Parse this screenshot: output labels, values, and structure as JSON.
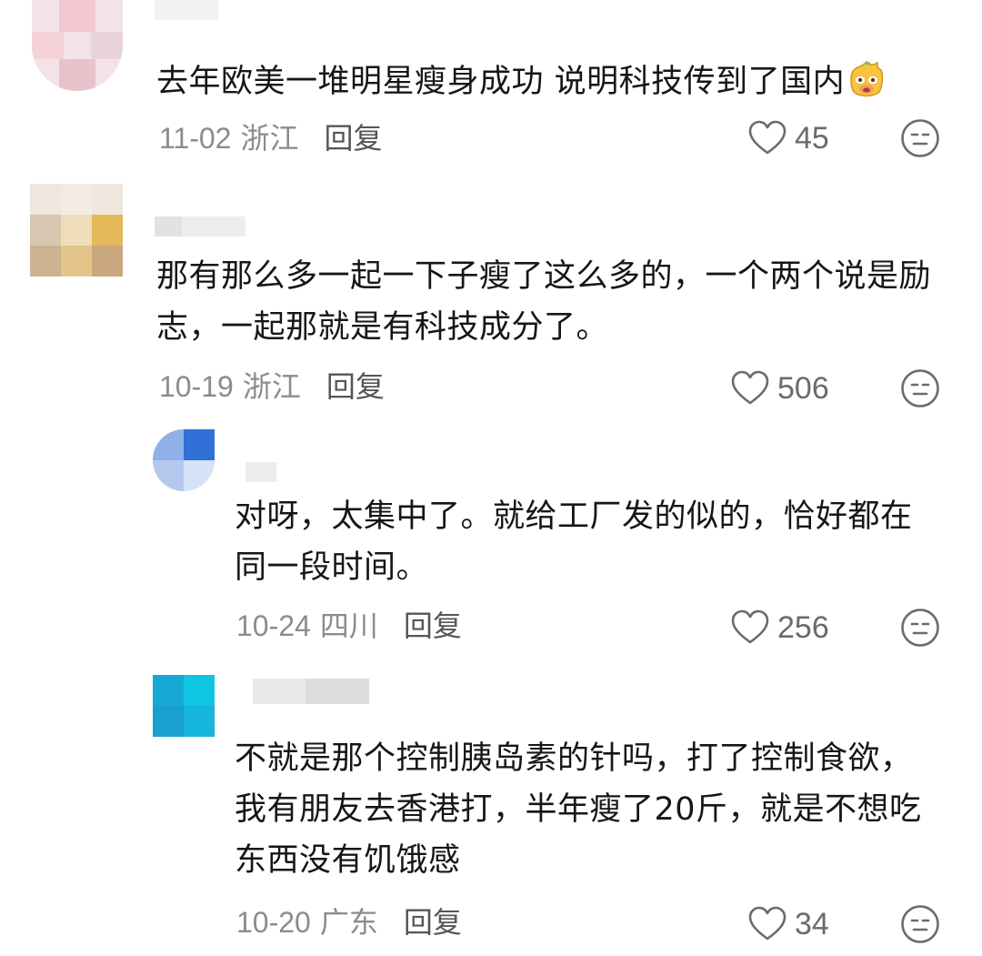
{
  "comments": [
    {
      "text": "去年欧美一堆明星瘦身成功 说明科技传到了国内",
      "emoji": "mascot-emoji",
      "date": "11-02",
      "location": "浙江",
      "reply_label": "回复",
      "likes": "45"
    },
    {
      "text": "那有那么多一起一下子瘦了这么多的，一个两个说是励志，一起那就是有科技成分了。",
      "date": "10-19",
      "location": "浙江",
      "reply_label": "回复",
      "likes": "506"
    },
    {
      "text": "对呀，太集中了。就给工厂发的似的，恰好都在同一段时间。",
      "date": "10-24",
      "location": "四川",
      "reply_label": "回复",
      "likes": "256"
    },
    {
      "text": "不就是那个控制胰岛素的针吗，打了控制食欲，我有朋友去香港打，半年瘦了20斤，就是不想吃东西没有饥饿感",
      "date": "10-20",
      "location": "广东",
      "reply_label": "回复",
      "likes": "34"
    }
  ],
  "icons": {
    "like": "heart-outline-icon",
    "dislike": "meh-face-icon"
  },
  "colors": {
    "text": "#161616",
    "meta": "#8c8c8c",
    "reply": "#555555",
    "icon": "#6b6b6b"
  }
}
